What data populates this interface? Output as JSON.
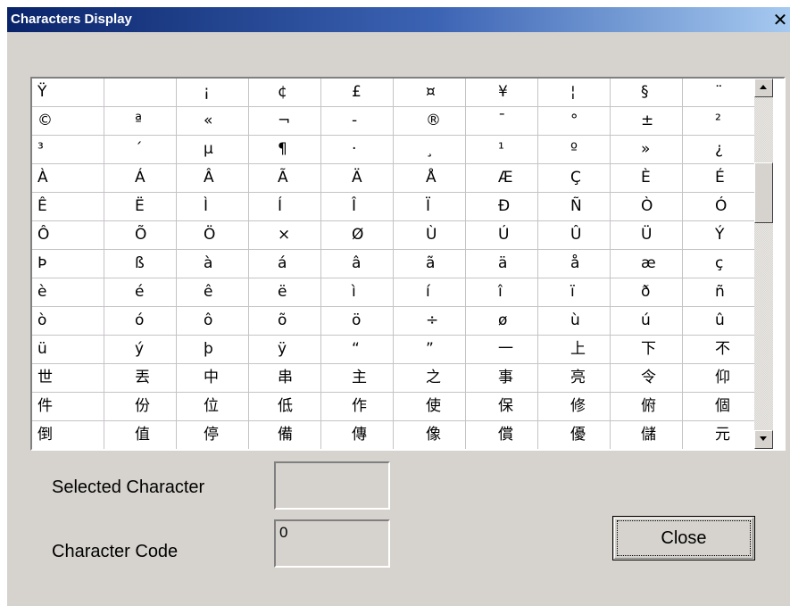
{
  "window": {
    "title": "Characters Display",
    "close_glyph": "✕"
  },
  "grid": {
    "rows": [
      [
        "Ÿ",
        "",
        "¡",
        "¢",
        "£",
        "¤",
        "¥",
        "¦",
        "§",
        "¨"
      ],
      [
        "©",
        "ª",
        "«",
        "¬",
        "-",
        "®",
        "¯",
        "°",
        "±",
        "²"
      ],
      [
        "³",
        "´",
        "µ",
        "¶",
        "·",
        "¸",
        "¹",
        "º",
        "»",
        "¿"
      ],
      [
        "À",
        "Á",
        "Â",
        "Ã",
        "Ä",
        "Å",
        "Æ",
        "Ç",
        "È",
        "É"
      ],
      [
        "Ê",
        "Ë",
        "Ì",
        "Í",
        "Î",
        "Ï",
        "Đ",
        "Ñ",
        "Ò",
        "Ó"
      ],
      [
        "Ô",
        "Õ",
        "Ö",
        "×",
        "Ø",
        "Ù",
        "Ú",
        "Û",
        "Ü",
        "Ý"
      ],
      [
        "Þ",
        "ß",
        "à",
        "á",
        "â",
        "ã",
        "ä",
        "å",
        "æ",
        "ç"
      ],
      [
        "è",
        "é",
        "ê",
        "ë",
        "ì",
        "í",
        "î",
        "ï",
        "ð",
        "ñ"
      ],
      [
        "ò",
        "ó",
        "ô",
        "õ",
        "ö",
        "÷",
        "ø",
        "ù",
        "ú",
        "û"
      ],
      [
        "ü",
        "ý",
        "þ",
        "ÿ",
        "“",
        "”",
        "一",
        "上",
        "下",
        "不"
      ],
      [
        "世",
        "丟",
        "中",
        "串",
        "主",
        "之",
        "事",
        "亮",
        "令",
        "仰"
      ],
      [
        "件",
        "份",
        "位",
        "低",
        "作",
        "使",
        "保",
        "修",
        "俯",
        "個"
      ],
      [
        "倒",
        "值",
        "停",
        "備",
        "傳",
        "像",
        "償",
        "優",
        "儲",
        "元"
      ]
    ]
  },
  "selected_character": {
    "label": "Selected Character",
    "value": ""
  },
  "character_code": {
    "label": "Character Code",
    "value": "0"
  },
  "buttons": {
    "close_label": "Close"
  },
  "colors": {
    "title_gradient_start": "#0a246a",
    "title_gradient_end": "#a6caf0",
    "dialog_face": "#d6d3ce",
    "grid_line": "#c6c3c6"
  }
}
